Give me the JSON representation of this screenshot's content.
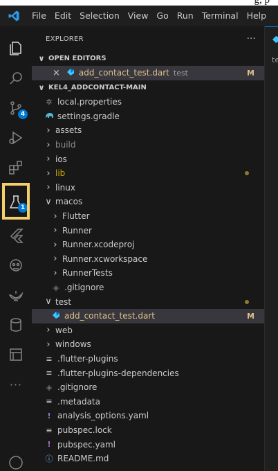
{
  "ghost_text": "g, p",
  "menu": [
    "File",
    "Edit",
    "Selection",
    "View",
    "Go",
    "Run",
    "Terminal",
    "Help"
  ],
  "activity": {
    "scm_badge": "4",
    "testing_badge": "1",
    "more": "···"
  },
  "explorer": {
    "title": "EXPLORER",
    "more": "···",
    "open_editors_label": "OPEN EDITORS",
    "open_editor": {
      "name": "add_contact_test.dart",
      "folder": "test",
      "status": "M"
    },
    "project_label": "KEL4_ADDCONTACT-MAIN",
    "items": [
      {
        "label": "local.properties",
        "icon": "gear-icon"
      },
      {
        "label": "settings.gradle",
        "icon": "gradle-icon"
      },
      {
        "label": "assets",
        "chevron": ">"
      },
      {
        "label": "build",
        "chevron": ">"
      },
      {
        "label": "ios",
        "chevron": ">"
      },
      {
        "label": "lib",
        "chevron": ">"
      },
      {
        "label": "linux",
        "chevron": ">"
      },
      {
        "label": "macos",
        "chevron": "v"
      },
      {
        "label": "Flutter",
        "chevron": ">"
      },
      {
        "label": "Runner",
        "chevron": ">"
      },
      {
        "label": "Runner.xcodeproj",
        "chevron": ">"
      },
      {
        "label": "Runner.xcworkspace",
        "chevron": ">"
      },
      {
        "label": "RunnerTests",
        "chevron": ">"
      },
      {
        "label": ".gitignore",
        "icon": "git-icon"
      },
      {
        "label": "test",
        "chevron": "v"
      },
      {
        "label": "add_contact_test.dart",
        "icon": "dart-icon",
        "status": "M"
      },
      {
        "label": "web",
        "chevron": ">"
      },
      {
        "label": "windows",
        "chevron": ">"
      },
      {
        "label": ".flutter-plugins",
        "icon": "lines-icon"
      },
      {
        "label": ".flutter-plugins-dependencies",
        "icon": "lines-icon"
      },
      {
        "label": ".gitignore",
        "icon": "git-icon"
      },
      {
        "label": ".metadata",
        "icon": "lines-icon"
      },
      {
        "label": "analysis_options.yaml",
        "icon": "yaml-icon"
      },
      {
        "label": "pubspec.lock",
        "icon": "lines-icon"
      },
      {
        "label": "pubspec.yaml",
        "icon": "yaml-icon"
      },
      {
        "label": "README.md",
        "icon": "info-icon"
      }
    ]
  },
  "editor_tab_label": "te",
  "colors": {
    "accent": "#0078d4",
    "highlight_box": "#f5d06a",
    "modified": "#e2c08d",
    "warning": "#cca700",
    "dart": "#40c4ff",
    "yaml": "#a074c4"
  },
  "icons": {
    "close": "×",
    "chevron_down": "∨",
    "chevron_right": "›",
    "exclaim": "!",
    "lines": "≡",
    "info": "ⓘ",
    "gear": "✲",
    "git": "◈"
  }
}
